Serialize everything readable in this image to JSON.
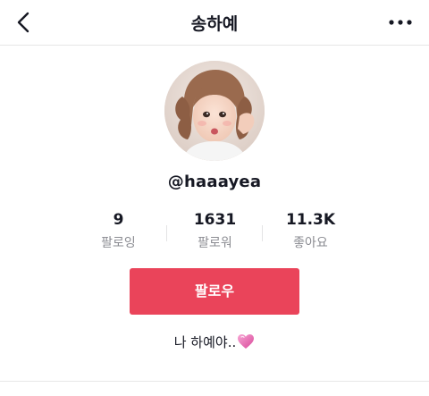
{
  "header": {
    "title": "송하예",
    "back_icon": "chevron-left-icon",
    "more_icon": "more-horizontal-icon"
  },
  "profile": {
    "username": "@haaayea",
    "avatar_alt": "profile photo"
  },
  "stats": [
    {
      "value": "9",
      "label": "팔로잉"
    },
    {
      "value": "1631",
      "label": "팔로워"
    },
    {
      "value": "11.3K",
      "label": "좋아요"
    }
  ],
  "follow_button": {
    "label": "팔로우",
    "color": "#ea445a"
  },
  "bio": {
    "text": "나 하예야..",
    "emoji": "heart-icon",
    "emoji_color": "#e05aa3"
  },
  "tabs": {
    "videos_icon": "grid-icon",
    "liked_icon": "heart-outline-icon"
  }
}
